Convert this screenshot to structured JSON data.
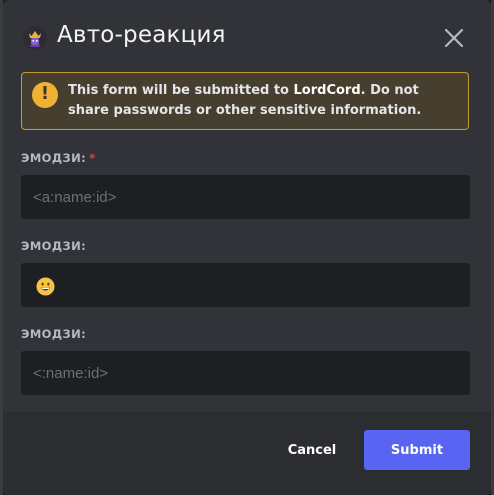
{
  "modal": {
    "title": "Авто-реакция",
    "app_icon": "crown-avatar-icon",
    "close_icon": "close-icon"
  },
  "warning": {
    "icon": "warning-icon",
    "glyph": "!",
    "text_before": "This form will be submitted to ",
    "app_name": "LordCord",
    "text_after": ". Do not share passwords or other sensitive information."
  },
  "fields": [
    {
      "label": "ЭМОДЗИ:",
      "required": true,
      "required_mark": "*",
      "placeholder": "<a:name:id>",
      "value": ""
    },
    {
      "label": "ЭМОДЗИ:",
      "required": false,
      "value_icon": "grinning-face-emoji-icon",
      "value": ""
    },
    {
      "label": "ЭМОДЗИ:",
      "required": false,
      "placeholder": "<:name:id>",
      "value": ""
    }
  ],
  "footer": {
    "cancel_label": "Cancel",
    "submit_label": "Submit"
  },
  "colors": {
    "accent": "#5865f2",
    "warning": "#f0b232",
    "required": "#f23f43",
    "background": "#313338",
    "input_bg": "#1e1f22"
  }
}
